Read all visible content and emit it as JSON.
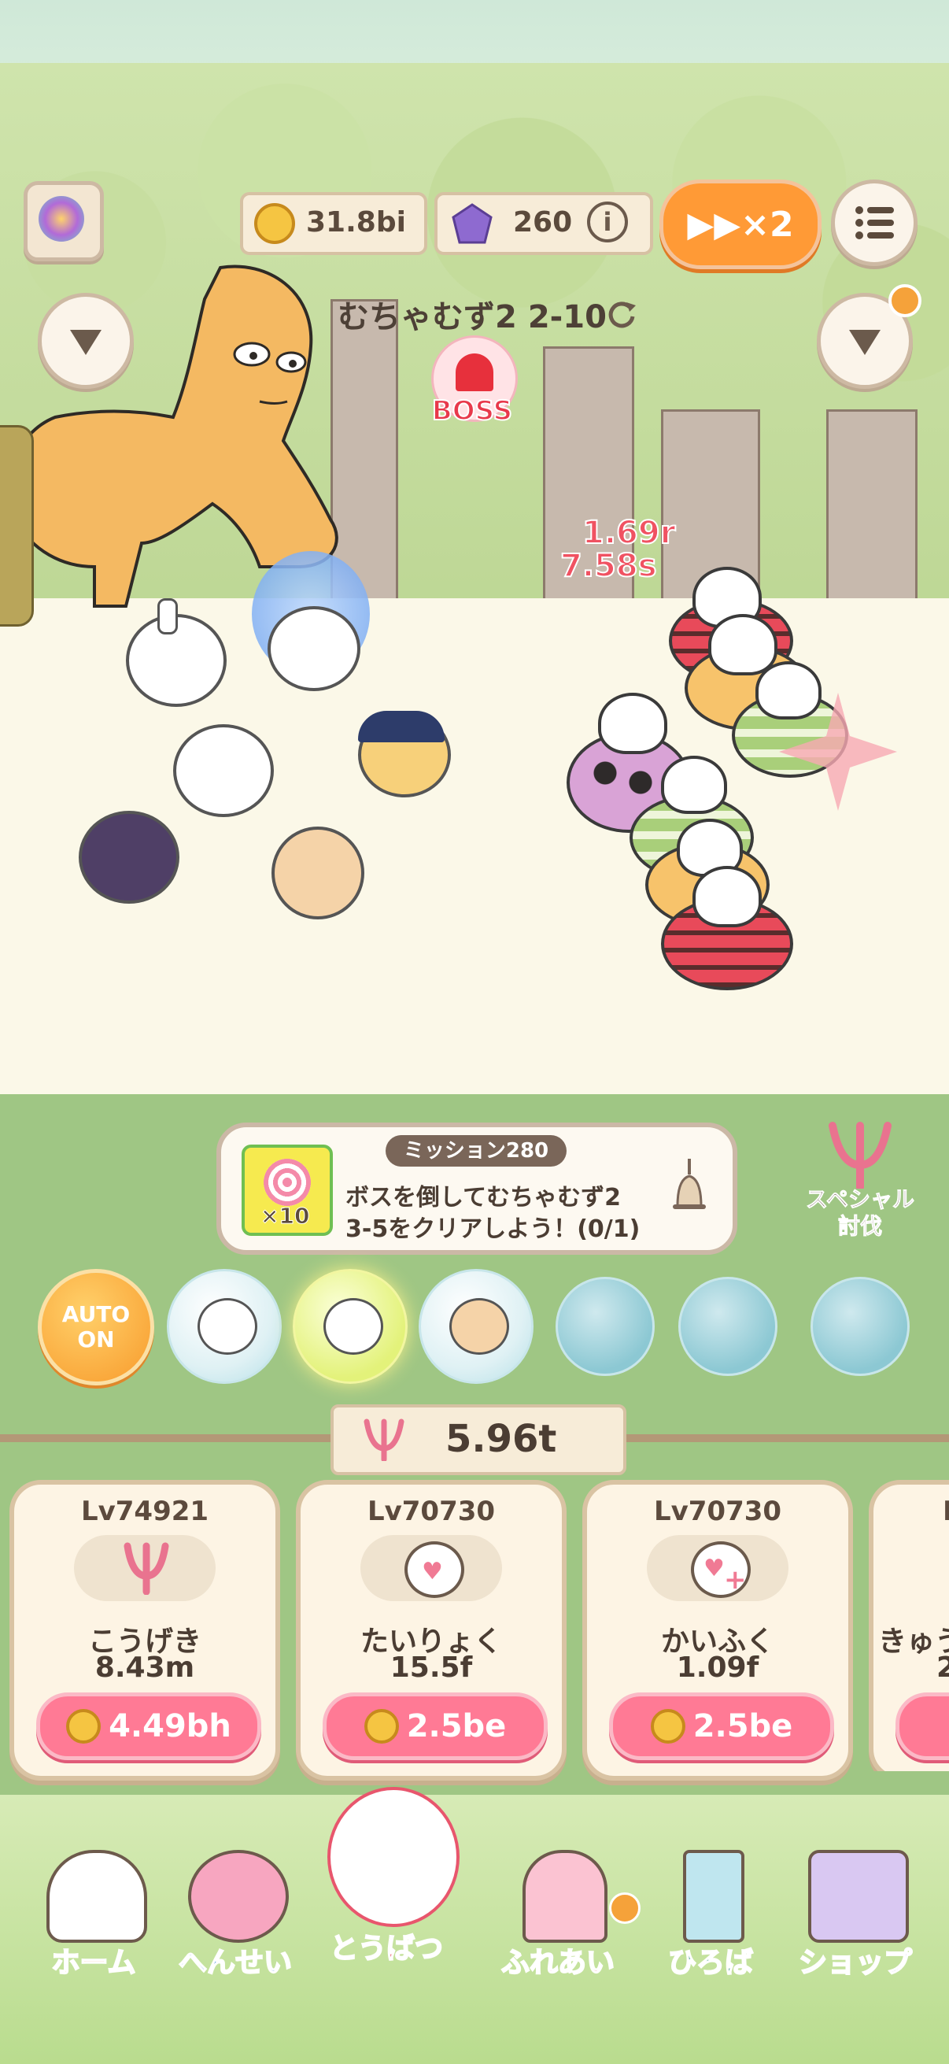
{
  "hud": {
    "coins": "31.8bi",
    "gems": "260",
    "speed_label": "▶▶×2"
  },
  "stage": {
    "title": "むちゃむず2 2-10",
    "boss_label": "BOSS"
  },
  "battle": {
    "damage_numbers": [
      "1.69r",
      "7.58s"
    ]
  },
  "mission": {
    "tag": "ミッション280",
    "line1": "ボスを倒してむちゃむず2",
    "line2": "3-5をクリアしよう！(0/1)",
    "reward_count": "×10"
  },
  "special": {
    "label_line1": "スペシャル",
    "label_line2": "討伐"
  },
  "auto": {
    "line1": "AUTO",
    "line2": "ON"
  },
  "power": {
    "total": "5.96t"
  },
  "cards": [
    {
      "level": "Lv74921",
      "name": "こうげき",
      "value": "8.43m",
      "cost": "4.49bh",
      "icon": "trident-icon"
    },
    {
      "level": "Lv70730",
      "name": "たいりょく",
      "value": "15.5f",
      "cost": "2.5be",
      "icon": "heart-bear-icon"
    },
    {
      "level": "Lv70730",
      "name": "かいふく",
      "value": "1.09f",
      "cost": "2.5be",
      "icon": "heal-bear-icon"
    },
    {
      "level": "L",
      "name": "きゅう",
      "value": "2",
      "cost": "",
      "icon": "partial"
    }
  ],
  "nav": [
    {
      "label": "ホーム",
      "color": "#f08a3b"
    },
    {
      "label": "へんせい",
      "color": "#4f8fd9"
    },
    {
      "label": "とうばつ",
      "color": "#e8566d"
    },
    {
      "label": "ふれあい",
      "color": "#f07a9a"
    },
    {
      "label": "ひろば",
      "color": "#4a9a8a"
    },
    {
      "label": "ショップ",
      "color": "#8a64c9"
    }
  ]
}
